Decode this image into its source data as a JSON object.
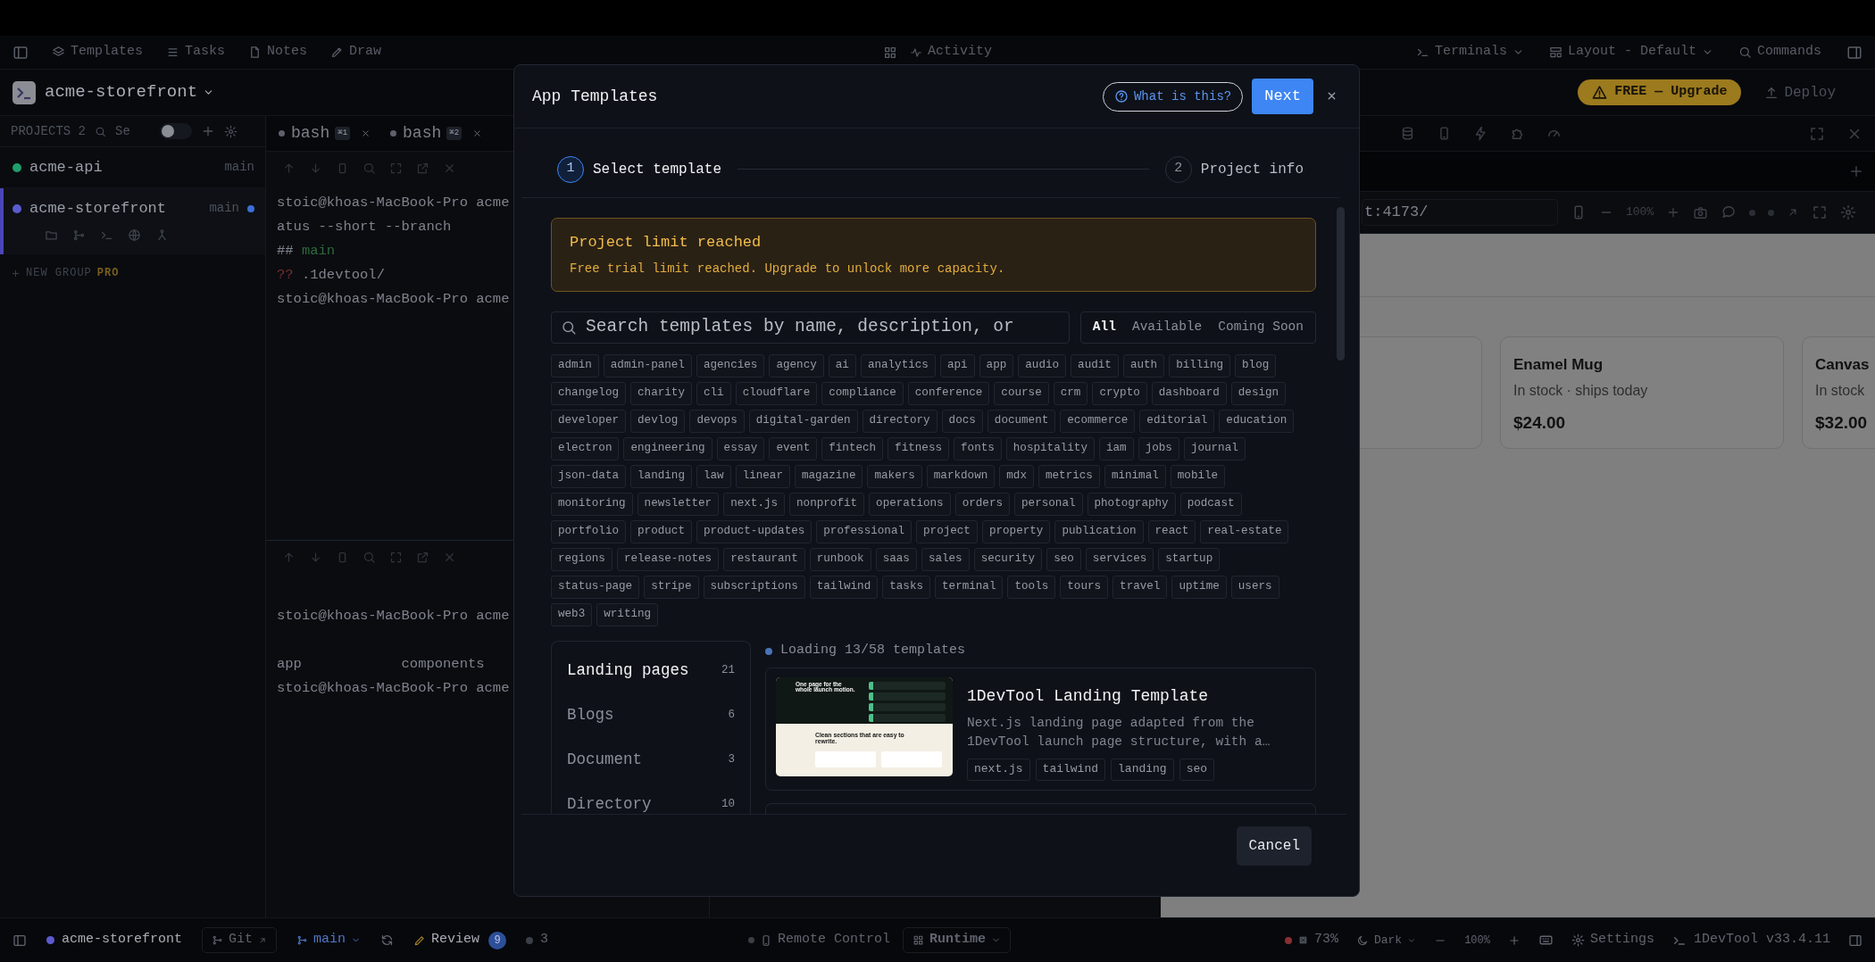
{
  "toolbar": {
    "nav": [
      "Templates",
      "Tasks",
      "Notes",
      "Draw"
    ],
    "activity": "Activity",
    "right": [
      "Terminals",
      "Layout - Default",
      "Commands"
    ]
  },
  "project_bar": {
    "name": "acme-storefront",
    "upgrade": "FREE — Upgrade",
    "deploy": "Deploy"
  },
  "sidebar": {
    "title": "PROJECTS 2",
    "search": {
      "placeholder": "Se"
    },
    "toggle_on": false,
    "projects": [
      {
        "name": "acme-api",
        "branch": "main",
        "color": "#1f9d6b",
        "selected": false,
        "changed": false
      },
      {
        "name": "acme-storefront",
        "branch": "main",
        "color": "#5b5bd0",
        "selected": true,
        "changed": true
      }
    ],
    "new_group": "NEW GROUP",
    "new_group_badge": "PRO"
  },
  "terminal": {
    "tabs": [
      {
        "label": "bash",
        "shortcut": "⌘1"
      },
      {
        "label": "bash",
        "shortcut": "⌘2"
      }
    ],
    "panes": [
      {
        "lines": [
          {
            "gap_before": false,
            "segments": [
              {
                "text": "stoic@khoas-MacBook-Pro acme",
                "kind": "plain"
              }
            ]
          },
          {
            "gap_before": false,
            "segments": [
              {
                "text": "atus --short --branch",
                "kind": "plain"
              }
            ]
          },
          {
            "gap_before": false,
            "segments": [
              {
                "text": "##",
                "kind": "plain"
              },
              {
                "text": "main",
                "kind": "branch"
              }
            ]
          },
          {
            "gap_before": false,
            "segments": [
              {
                "text": "??",
                "kind": "untracked"
              },
              {
                "text": ".1devtool/",
                "kind": "plain"
              }
            ]
          },
          {
            "gap_before": false,
            "segments": [
              {
                "text": "stoic@khoas-MacBook-Pro acme",
                "kind": "plain"
              }
            ]
          }
        ]
      },
      {
        "lines": [
          {
            "gap_before": true,
            "segments": [
              {
                "text": "stoic@khoas-MacBook-Pro acme",
                "kind": "plain"
              }
            ]
          },
          {
            "gap_before": true,
            "segments": [
              {
                "text": "app            components",
                "kind": "plain"
              }
            ]
          },
          {
            "gap_before": false,
            "segments": [
              {
                "text": "stoic@khoas-MacBook-Pro acme",
                "kind": "plain"
              }
            ]
          }
        ]
      }
    ]
  },
  "preview": {
    "url": "t:4173/",
    "zoom": "100%",
    "products": [
      {
        "name": "Enamel Mug",
        "stock": "In stock · ships today",
        "price": "$24.00"
      },
      {
        "name": "Canvas",
        "stock": "In stock",
        "price": "$32.00"
      }
    ]
  },
  "modal": {
    "title": "App Templates",
    "help": "What is this?",
    "next": "Next",
    "steps": [
      {
        "number": "1",
        "label": "Select template",
        "selected": true
      },
      {
        "number": "2",
        "label": "Project info",
        "selected": false
      }
    ],
    "alert": {
      "title": "Project limit reached",
      "text": "Free trial limit reached. Upgrade to unlock more capacity."
    },
    "search": {
      "placeholder": "Search templates by name, description, or"
    },
    "filters": [
      {
        "label": "All",
        "selected": true
      },
      {
        "label": "Available",
        "selected": false
      },
      {
        "label": "Coming Soon",
        "selected": false
      }
    ],
    "tag_rows": [
      [
        "admin",
        "admin-panel",
        "agencies",
        "agency",
        "ai",
        "analytics",
        "api",
        "app",
        "audio",
        "audit",
        "auth",
        "billing",
        "blog"
      ],
      [
        "changelog",
        "charity",
        "cli",
        "cloudflare",
        "compliance",
        "conference",
        "course",
        "crm",
        "crypto",
        "dashboard",
        "design"
      ],
      [
        "developer",
        "devlog",
        "devops",
        "digital-garden",
        "directory",
        "docs",
        "document",
        "ecommerce",
        "editorial",
        "education"
      ],
      [
        "electron",
        "engineering",
        "essay",
        "event",
        "fintech",
        "fitness",
        "fonts",
        "hospitality",
        "iam",
        "jobs",
        "journal"
      ],
      [
        "json-data",
        "landing",
        "law",
        "linear",
        "magazine",
        "makers",
        "markdown",
        "mdx",
        "metrics",
        "minimal",
        "mobile"
      ],
      [
        "monitoring",
        "newsletter",
        "next.js",
        "nonprofit",
        "operations",
        "orders",
        "personal",
        "photography",
        "podcast"
      ],
      [
        "portfolio",
        "product",
        "product-updates",
        "professional",
        "project",
        "property",
        "publication",
        "react",
        "real-estate"
      ],
      [
        "regions",
        "release-notes",
        "restaurant",
        "runbook",
        "saas",
        "sales",
        "security",
        "seo",
        "services",
        "startup"
      ],
      [
        "status-page",
        "stripe",
        "subscriptions",
        "tailwind",
        "tasks",
        "terminal",
        "tools",
        "tours",
        "travel",
        "uptime",
        "users"
      ],
      [
        "web3",
        "writing"
      ]
    ],
    "categories": [
      {
        "label": "Landing pages",
        "count": "21",
        "selected": true
      },
      {
        "label": "Blogs",
        "count": "6",
        "selected": false
      },
      {
        "label": "Document",
        "count": "3",
        "selected": false
      },
      {
        "label": "Directory",
        "count": "10",
        "selected": false
      }
    ],
    "loading": "Loading 13/58 templates",
    "templates": [
      {
        "title": "1DevTool Landing Template",
        "description": "Next.js landing page adapted from the 1DevTool launch page structure, with a…",
        "tags": [
          "next.js",
          "tailwind",
          "landing",
          "seo"
        ],
        "preview": {
          "headline": "One page for the whole launch motion.",
          "subhead": "Clean sections that are easy to rewrite."
        }
      }
    ],
    "cancel": "Cancel"
  },
  "status_bar": {
    "project": "acme-storefront",
    "git": "Git",
    "branch": "main",
    "review": "Review",
    "review_count": "9",
    "count": "3",
    "remote": "Remote Control",
    "runtime": "Runtime",
    "battery": "73%",
    "theme": "Dark",
    "zoom": "100%",
    "settings": "Settings",
    "version": "1DevTool v33.4.11"
  }
}
